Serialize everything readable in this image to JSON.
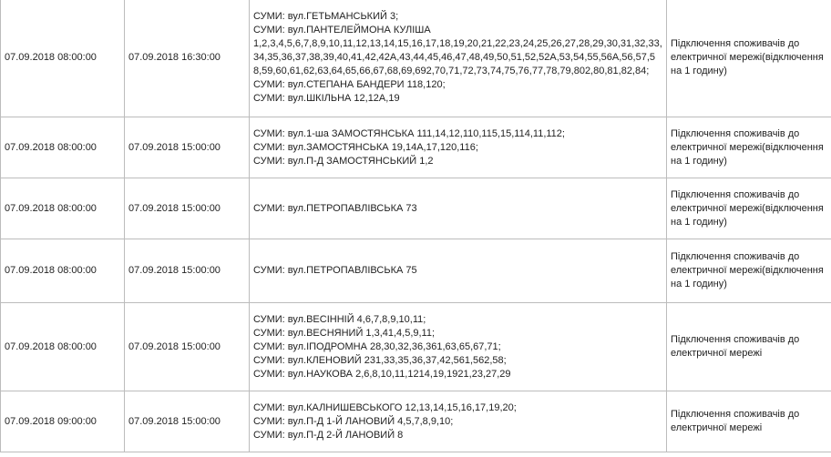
{
  "rows": [
    {
      "start": "07.09.2018  08:00:00",
      "end": "07.09.2018  16:30:00",
      "address_lines": [
        "СУМИ: вул.ГЕТЬМАНСЬКИЙ 3;",
        "СУМИ: вул.ПАНТЕЛЕЙМОНА КУЛІША",
        "1,2,3,4,5,6,7,8,9,10,11,12,13,14,15,16,17,18,19,20,21,22,23,24,25,26,27,28,29,30,31,32,33,34,35,36,37,38,39,40,41,42,42А,43,44,45,46,47,48,49,50,51,52,52А,53,54,55,56А,56,57,58,59,60,61,62,63,64,65,66,67,68,69,692,70,71,72,73,74,75,76,77,78,79,802,80,81,82,84;",
        "СУМИ: вул.СТЕПАНА БАНДЕРИ 118,120;",
        "СУМИ: вул.ШКІЛЬНА 12,12А,19"
      ],
      "description": "Підключення споживачів до електричної мережі(відключення на 1 годину)"
    },
    {
      "start": "07.09.2018  08:00:00",
      "end": "07.09.2018  15:00:00",
      "address_lines": [
        "СУМИ: вул.1-ша ЗАМОСТЯНСЬКА 111,14,12,110,115,15,114,11,112;",
        "СУМИ: вул.ЗАМОСТЯНСЬКА 19,14А,17,120,116;",
        "СУМИ: вул.П-Д ЗАМОСТЯНСЬКИЙ 1,2"
      ],
      "description": "Підключення споживачів до електричної мережі(відключення на 1 годину)"
    },
    {
      "start": "07.09.2018  08:00:00",
      "end": "07.09.2018  15:00:00",
      "address_lines": [
        "СУМИ: вул.ПЕТРОПАВЛІВСЬКА 73"
      ],
      "description": "Підключення споживачів до електричної мережі(відключення на 1 годину)"
    },
    {
      "start": "07.09.2018  08:00:00",
      "end": "07.09.2018  15:00:00",
      "address_lines": [
        "СУМИ: вул.ПЕТРОПАВЛІВСЬКА 75"
      ],
      "description": "Підключення споживачів до електричної мережі(відключення на 1 годину)"
    },
    {
      "start": "07.09.2018  08:00:00",
      "end": "07.09.2018  15:00:00",
      "address_lines": [
        "СУМИ: вул.ВЕСІННІЙ 4,6,7,8,9,10,11;",
        "СУМИ: вул.ВЕСНЯНИЙ 1,3,41,4,5,9,11;",
        "СУМИ: вул.ІПОДРОМНА 28,30,32,36,361,63,65,67,71;",
        "СУМИ: вул.КЛЕНОВИЙ 231,33,35,36,37,42,561,562,58;",
        "СУМИ: вул.НАУКОВА 2,6,8,10,11,1214,19,1921,23,27,29"
      ],
      "description": "Підключення споживачів до електричної мережі"
    },
    {
      "start": "07.09.2018  09:00:00",
      "end": "07.09.2018  15:00:00",
      "address_lines": [
        "СУМИ: вул.КАЛНИШЕВСЬКОГО 12,13,14,15,16,17,19,20;",
        "СУМИ: вул.П-Д 1-Й ЛАНОВИЙ 4,5,7,8,9,10;",
        "СУМИ: вул.П-Д 2-Й ЛАНОВИЙ 8"
      ],
      "description": "Підключення споживачів до електричної мережі"
    }
  ]
}
